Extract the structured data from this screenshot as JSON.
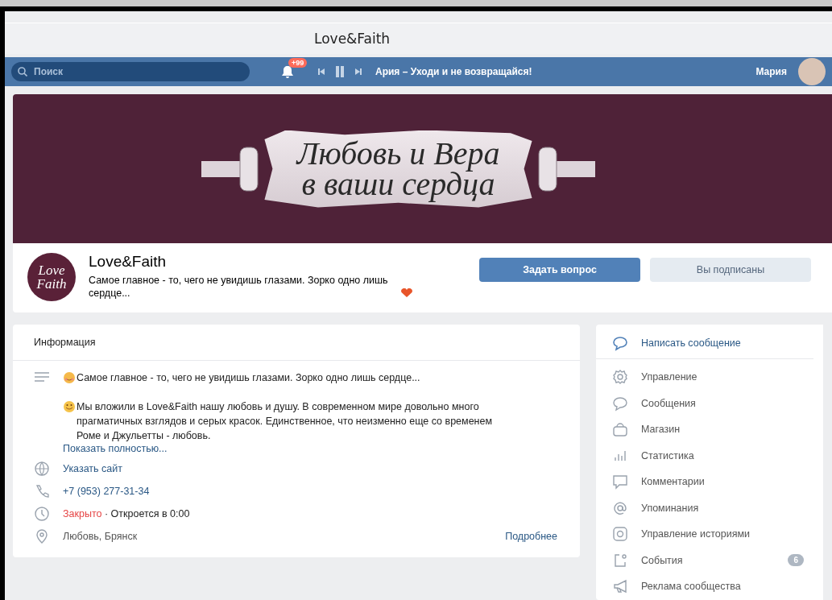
{
  "window": {
    "title": "Love&Faith"
  },
  "header": {
    "search": {
      "placeholder": "Поиск"
    },
    "notifications_badge": "+99",
    "player": {
      "playing": true,
      "track": "Ария – Уходи и не возвращайся!"
    },
    "user": {
      "name": "Мария"
    }
  },
  "cover": {
    "lines": [
      "Любовь и Вера",
      "в ваши сердца"
    ]
  },
  "group": {
    "logo_lines": [
      "Love",
      "Faith"
    ],
    "name": "Love&Faith",
    "status": "Самое главное - то, чего не увидишь глазами. Зорко одно лишь сердце...",
    "buttons": [
      {
        "label": "Задать вопрос",
        "kind": "primary"
      },
      {
        "label": "Вы подписаны",
        "kind": "secondary"
      }
    ]
  },
  "info": {
    "title": "Информация",
    "description": [
      "Самое главное - то, чего не увидишь глазами. Зорко одно лишь сердце...",
      "Мы вложили в Love&Faith нашу любовь и душу. В современном мире довольно много прагматичных взглядов и серых красок. Единственное, что неизменно еще со временем Роме и Джульетты - любовь."
    ],
    "show_more": "Показать полностью...",
    "rows": [
      {
        "kind": "site",
        "text": "Указать сайт"
      },
      {
        "kind": "phone",
        "text": "+7 (953) 277-31-34"
      },
      {
        "kind": "hours",
        "status": "Закрыто",
        "text": "· Откроется в 0:00"
      },
      {
        "kind": "address",
        "text": "Любовь, Брянск",
        "link": "Подробнее"
      }
    ]
  },
  "menu": [
    {
      "label": "Написать сообщение",
      "kind": "action"
    },
    {
      "label": "Управление",
      "kind": "item"
    },
    {
      "label": "Сообщения",
      "kind": "item"
    },
    {
      "label": "Магазин",
      "kind": "item"
    },
    {
      "label": "Статистика",
      "kind": "item"
    },
    {
      "label": "Комментарии",
      "kind": "item"
    },
    {
      "label": "Упоминания",
      "kind": "item"
    },
    {
      "label": "Управление историями",
      "kind": "item"
    },
    {
      "label": "События",
      "kind": "item",
      "badge": "6"
    },
    {
      "label": "Реклама сообщества",
      "kind": "item"
    }
  ]
}
